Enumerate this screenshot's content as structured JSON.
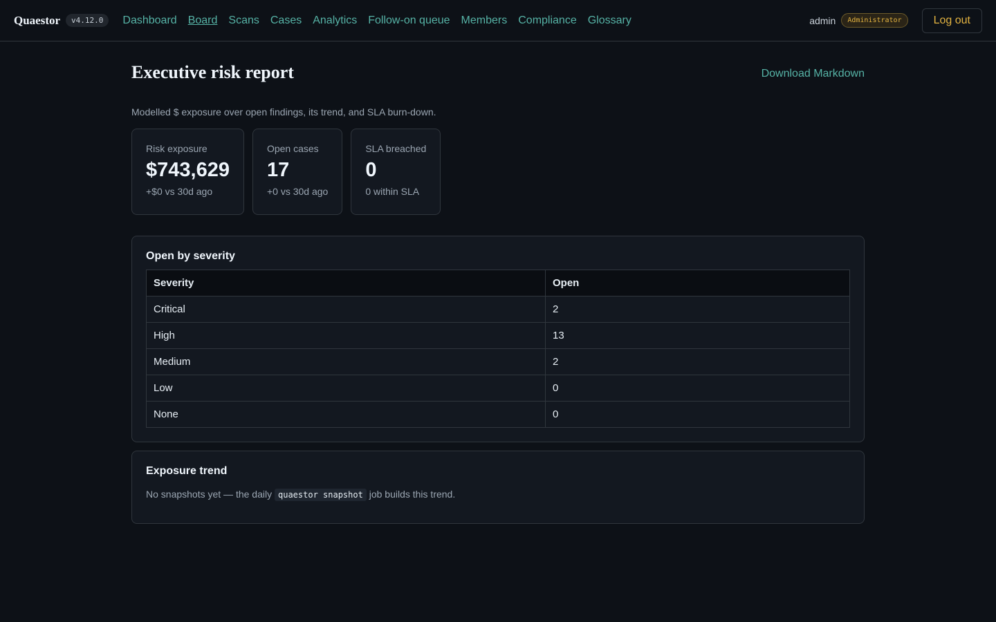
{
  "app": {
    "brand": "Quaestor",
    "version": "v4.12.0"
  },
  "nav": {
    "items": [
      {
        "label": "Dashboard",
        "active": false
      },
      {
        "label": "Board",
        "active": true
      },
      {
        "label": "Scans",
        "active": false
      },
      {
        "label": "Cases",
        "active": false
      },
      {
        "label": "Analytics",
        "active": false
      },
      {
        "label": "Follow-on queue",
        "active": false
      },
      {
        "label": "Members",
        "active": false
      },
      {
        "label": "Compliance",
        "active": false
      },
      {
        "label": "Glossary",
        "active": false
      }
    ]
  },
  "user": {
    "name": "admin",
    "role": "Administrator",
    "logout_label": "Log out"
  },
  "page": {
    "title": "Executive risk report",
    "download_label": "Download Markdown",
    "subtitle": "Modelled $ exposure over open findings, its trend, and SLA burn-down."
  },
  "kpis": [
    {
      "label": "Risk exposure",
      "value": "$743,629",
      "sub": "+$0 vs 30d ago"
    },
    {
      "label": "Open cases",
      "value": "17",
      "sub": "+0 vs 30d ago"
    },
    {
      "label": "SLA breached",
      "value": "0",
      "sub": "0 within SLA"
    }
  ],
  "severity": {
    "title": "Open by severity",
    "headers": [
      "Severity",
      "Open"
    ],
    "rows": [
      [
        "Critical",
        "2"
      ],
      [
        "High",
        "13"
      ],
      [
        "Medium",
        "2"
      ],
      [
        "Low",
        "0"
      ],
      [
        "None",
        "0"
      ]
    ]
  },
  "trend": {
    "title": "Exposure trend",
    "text_before": "No snapshots yet — the daily ",
    "code": "quaestor snapshot",
    "text_after": " job builds this trend."
  },
  "colors": {
    "background": "#0d1117",
    "accent_link": "#56b3a6",
    "role_badge": "#e3b341"
  }
}
